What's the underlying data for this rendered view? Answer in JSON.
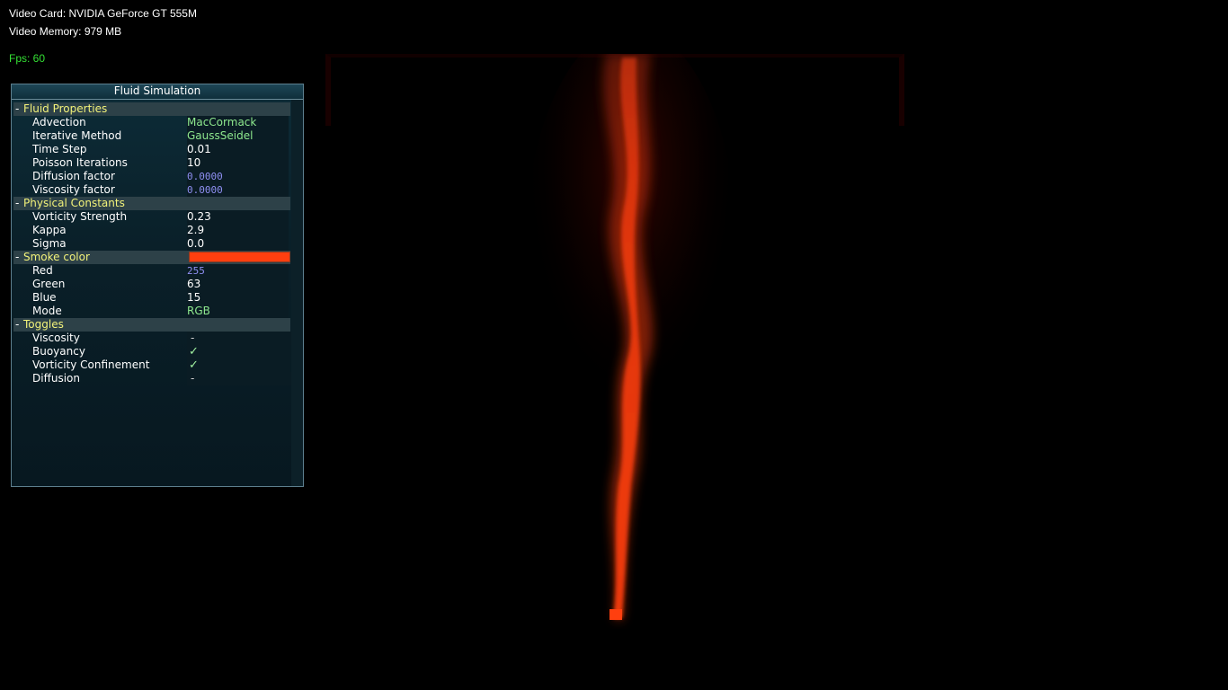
{
  "hud": {
    "video_card": "Video Card: NVIDIA GeForce GT 555M",
    "video_memory": "Video Memory: 979 MB",
    "fps": "Fps: 60"
  },
  "panel": {
    "title": "Fluid Simulation",
    "groups": [
      {
        "toggle": "-",
        "label": "Fluid Properties",
        "items": [
          {
            "label": "Advection",
            "value": "MacCormack",
            "kind": "enum"
          },
          {
            "label": "Iterative Method",
            "value": "GaussSeidel",
            "kind": "enum"
          },
          {
            "label": "Time Step",
            "value": "0.01",
            "kind": "num"
          },
          {
            "label": "Poisson Iterations",
            "value": "10",
            "kind": "num"
          },
          {
            "label": "Diffusion factor",
            "value": "0.0000",
            "kind": "edit"
          },
          {
            "label": "Viscosity factor",
            "value": "0.0000",
            "kind": "edit"
          }
        ]
      },
      {
        "toggle": "-",
        "label": "Physical Constants",
        "items": [
          {
            "label": "Vorticity Strength",
            "value": "0.23",
            "kind": "num"
          },
          {
            "label": "Kappa",
            "value": "2.9",
            "kind": "num"
          },
          {
            "label": "Sigma",
            "value": "0.0",
            "kind": "num"
          }
        ]
      },
      {
        "toggle": "-",
        "label": "Smoke color",
        "swatch": "#ff3f0f",
        "items": [
          {
            "label": "Red",
            "value": "255",
            "kind": "edit"
          },
          {
            "label": "Green",
            "value": "63",
            "kind": "num"
          },
          {
            "label": "Blue",
            "value": "15",
            "kind": "num"
          },
          {
            "label": "Mode",
            "value": "RGB",
            "kind": "enum"
          }
        ]
      },
      {
        "toggle": "-",
        "label": "Toggles",
        "items": [
          {
            "label": "Viscosity",
            "value": "-",
            "kind": "dash"
          },
          {
            "label": "Buoyancy",
            "value": "✓",
            "kind": "check"
          },
          {
            "label": "Vorticity Confinement",
            "value": "✓",
            "kind": "check"
          },
          {
            "label": "Diffusion",
            "value": "-",
            "kind": "dash"
          }
        ]
      }
    ]
  },
  "colors": {
    "smoke": "#ff3f0f",
    "fps_text": "#34e034",
    "group_label": "#f2f27a",
    "enum_value": "#8ee88e",
    "edit_value": "#8f8ff2"
  }
}
